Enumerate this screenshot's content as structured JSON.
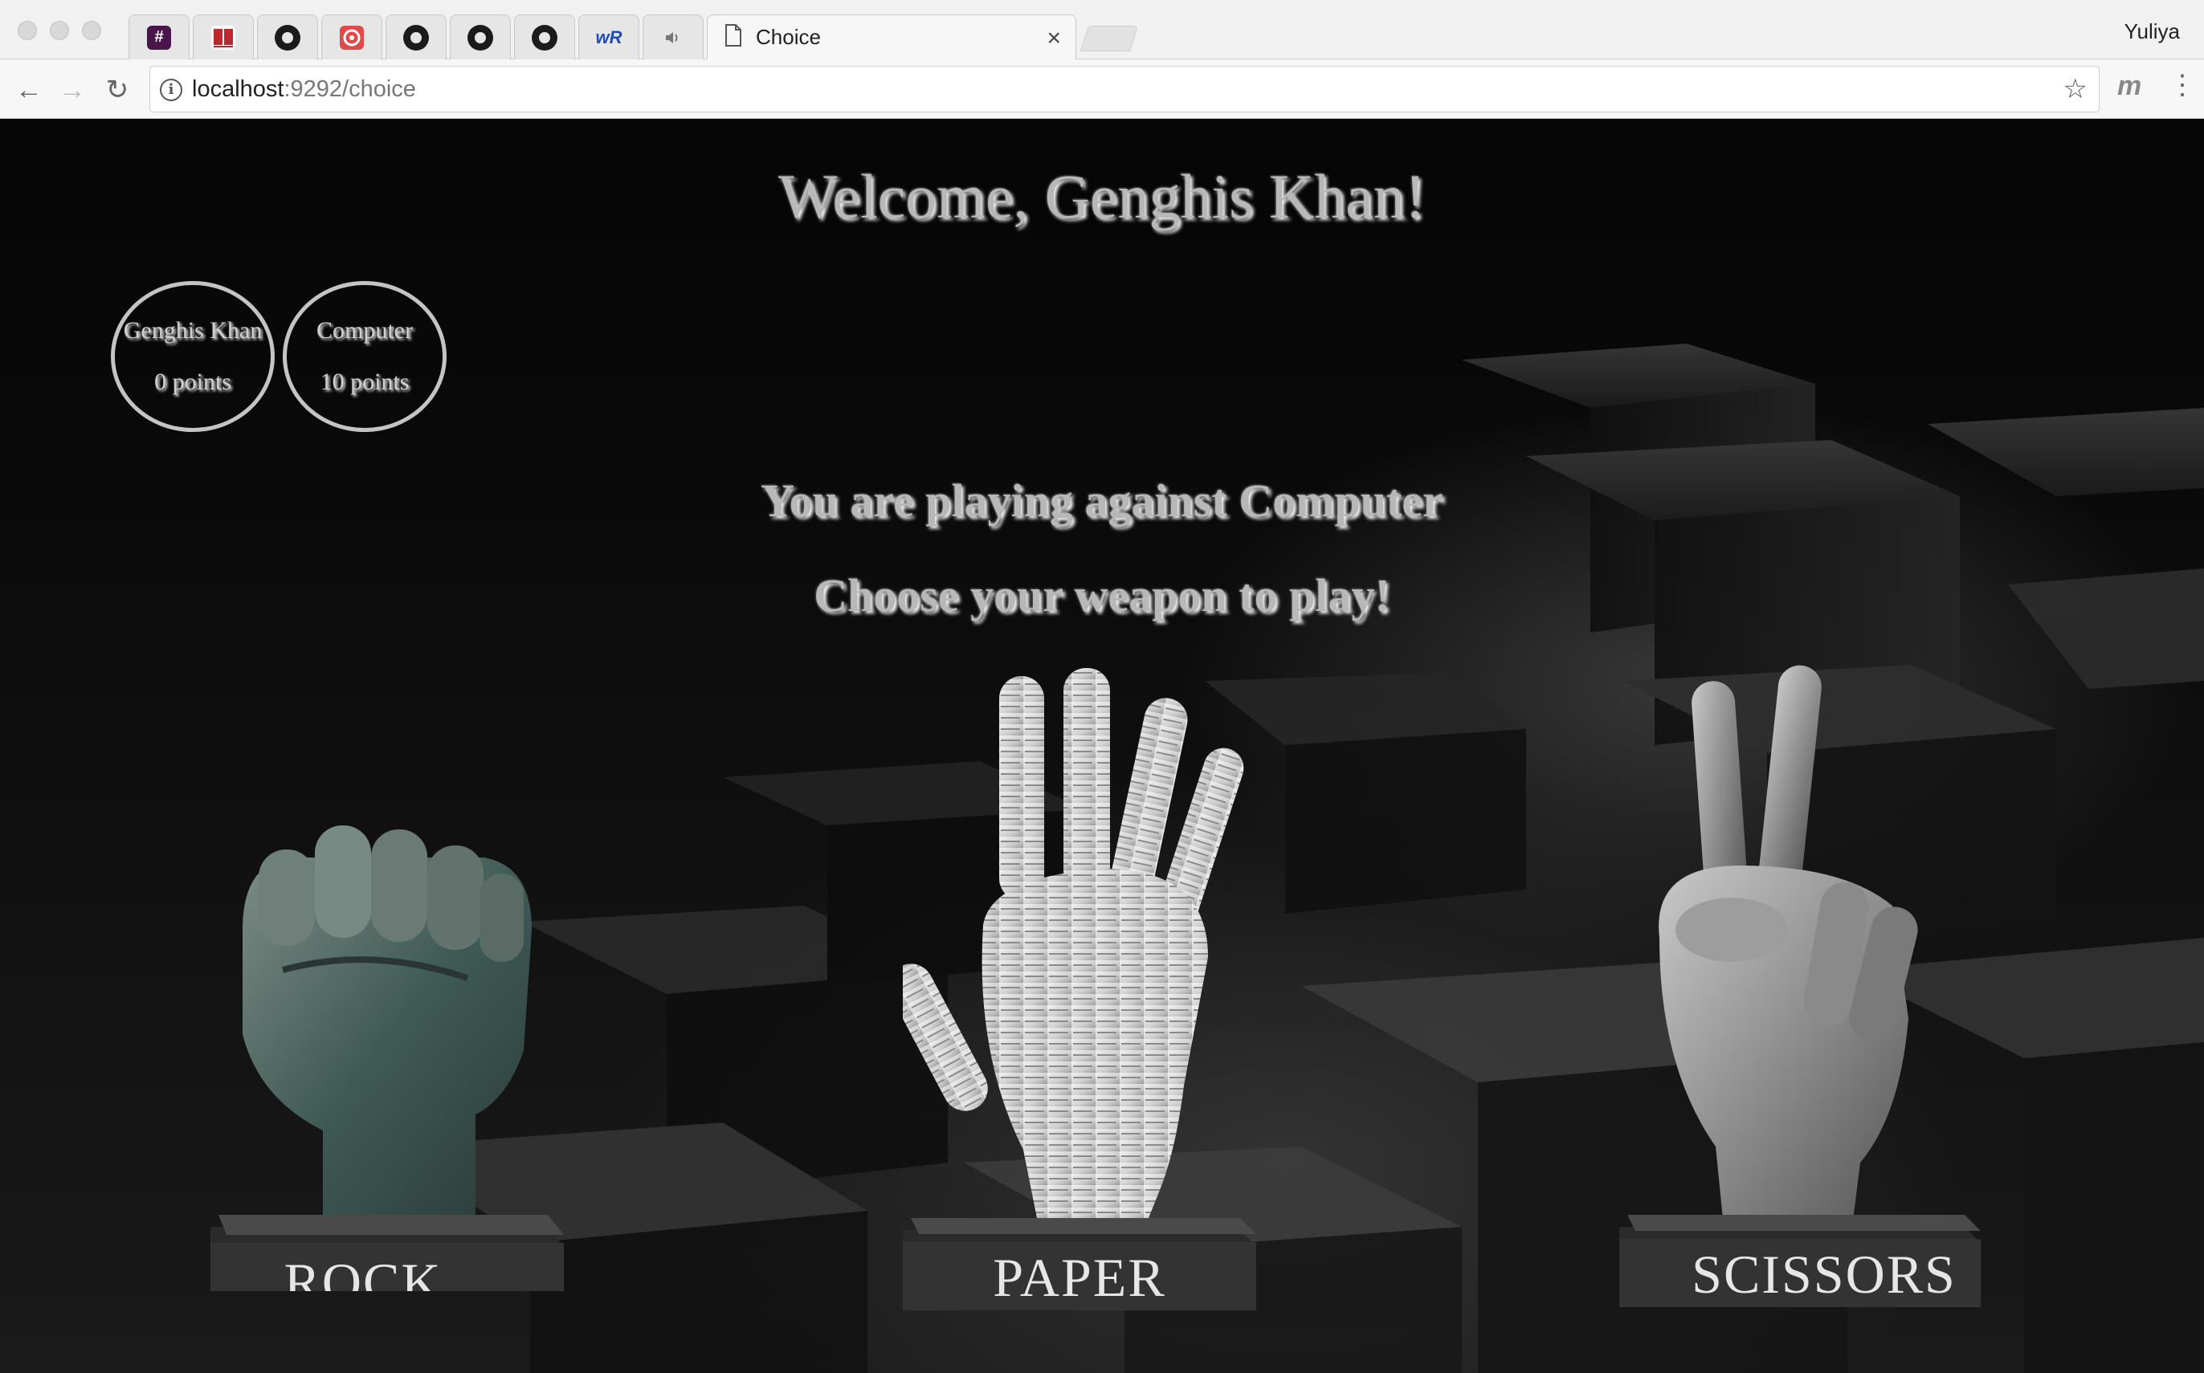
{
  "browser": {
    "tabs": [
      {
        "icon": "slack-hash-icon"
      },
      {
        "icon": "book-icon"
      },
      {
        "icon": "github-icon"
      },
      {
        "icon": "codeschool-icon"
      },
      {
        "icon": "github-icon"
      },
      {
        "icon": "github-icon"
      },
      {
        "icon": "github-icon"
      },
      {
        "icon": "wordreference-icon",
        "text": "wR"
      },
      {
        "icon": "speaker-icon"
      }
    ],
    "active_tab": {
      "title": "Choice",
      "close": "×"
    },
    "profile": "Yuliya",
    "url_host": "localhost",
    "url_path": ":9292/choice",
    "extension_letter": "m",
    "menu": "⋮"
  },
  "page": {
    "welcome": "Welcome, Genghis Khan!",
    "players": [
      {
        "name": "Genghis Khan",
        "points": "0 points"
      },
      {
        "name": "Computer",
        "points": "10 points"
      }
    ],
    "opponent_text": "You are playing against Computer",
    "prompt_text": "Choose your weapon to play!",
    "weapons": [
      {
        "label": "ROCK",
        "icon": "fist-statue-icon"
      },
      {
        "label": "PAPER",
        "icon": "open-hand-statue-icon"
      },
      {
        "label": "SCISSORS",
        "icon": "two-fingers-statue-icon"
      }
    ]
  },
  "colors": {
    "background": "#000000",
    "heading_text": "#b8b8b8",
    "score_ring": "#c4c4c4"
  }
}
